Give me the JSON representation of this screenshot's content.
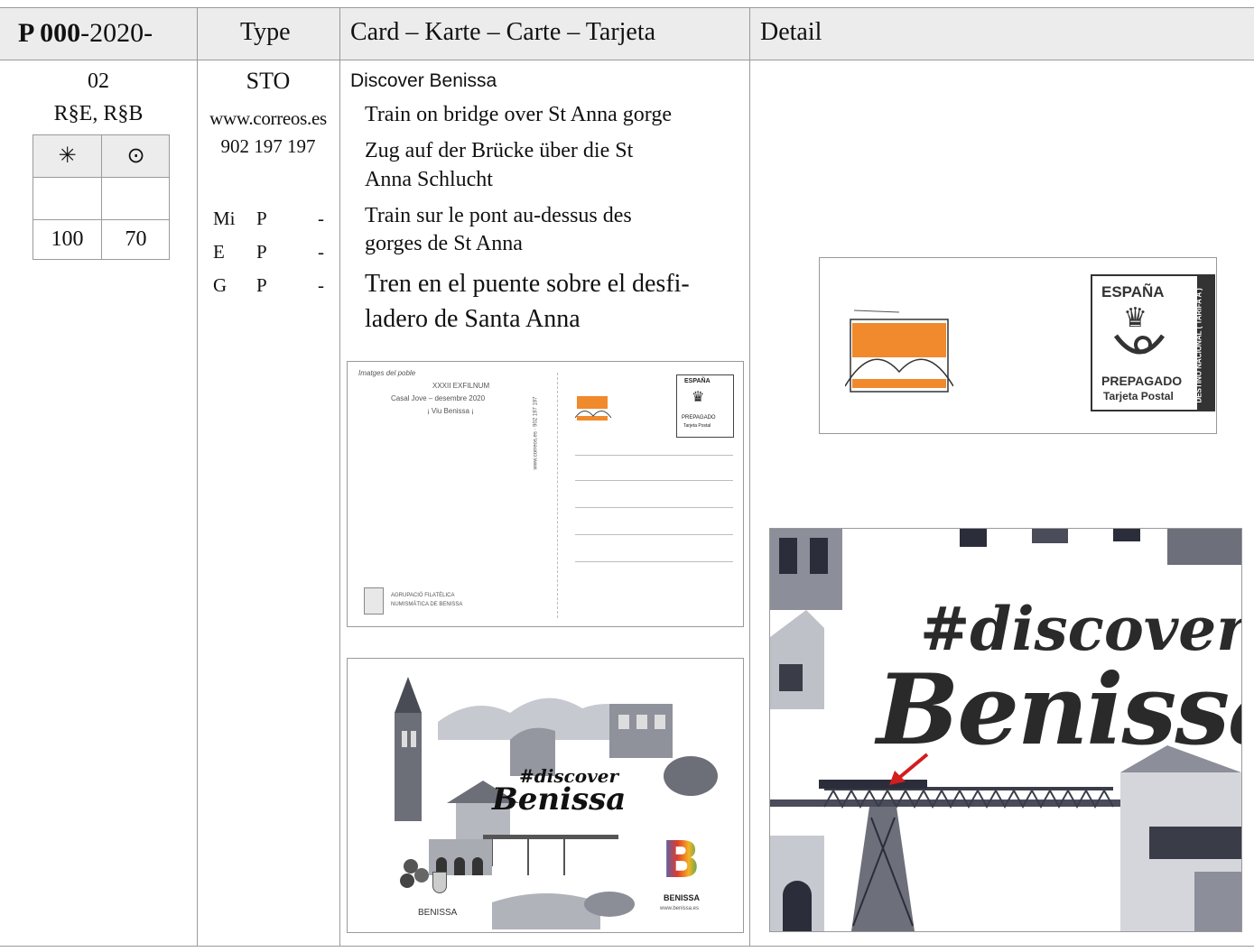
{
  "header": {
    "catalog_bold": "P 000",
    "catalog_rest": "-2020-",
    "type": "Type",
    "card": "Card – Karte – Carte – Tarjeta",
    "detail": "Detail"
  },
  "row": {
    "number": "02",
    "codes": "R§E, R§B",
    "prices": {
      "mint_symbol": "✳",
      "used_symbol": "⊙",
      "mint_value": "100",
      "used_value": "70"
    },
    "type": {
      "code": "STO",
      "website": "www.correos.es",
      "phone": "902 197 197",
      "printings": [
        {
          "a": "Mi",
          "b": "P",
          "c": "-"
        },
        {
          "a": "E",
          "b": "P",
          "c": "-"
        },
        {
          "a": "G",
          "b": "P",
          "c": "-"
        }
      ]
    },
    "card": {
      "title": "Discover Benissa",
      "en": "Train on bridge over St Anna gorge",
      "de_1": "Zug auf der Brücke über die St",
      "de_2": "Anna Schlucht",
      "fr_1": "Train sur le pont au-dessus des",
      "fr_2": "gorges de St Anna",
      "es_1": "Tren en el puente sobre el desfi-",
      "es_2": "ladero de Santa Anna"
    },
    "back_image": {
      "line1": "Imatges del poble",
      "line2": "XXXII  EXFILNUM",
      "line3": "Casal Jove – desembre 2020",
      "line4": "¡ Viu Benissa ¡",
      "footer1": "AGRUPACIÓ FILATÈLICA",
      "footer2": "NUMISMÀTICA DE BENISSA",
      "vertical": "www.correos.es  ·  902 197 197"
    },
    "front_image": {
      "hashtag": "#discover",
      "name": "Benissa",
      "logo_letter": "B",
      "logo_text": "BENISSA",
      "logo_url": "www.benissa.es",
      "coat_text": "BENISSA"
    },
    "stamp": {
      "country": "ESPAÑA",
      "label": "PREPAGADO",
      "sub": "Tarjeta Postal",
      "side": "DESTINO NACIONAL ( TARIFA A )"
    },
    "detail_zoom": {
      "hashtag": "#discover",
      "name": "Benissa"
    }
  },
  "colors": {
    "header_bg": "#ececec",
    "grid": "#9a9a9a",
    "stamp_orange": "#f08a2c",
    "arrow_red": "#d21e1e"
  }
}
